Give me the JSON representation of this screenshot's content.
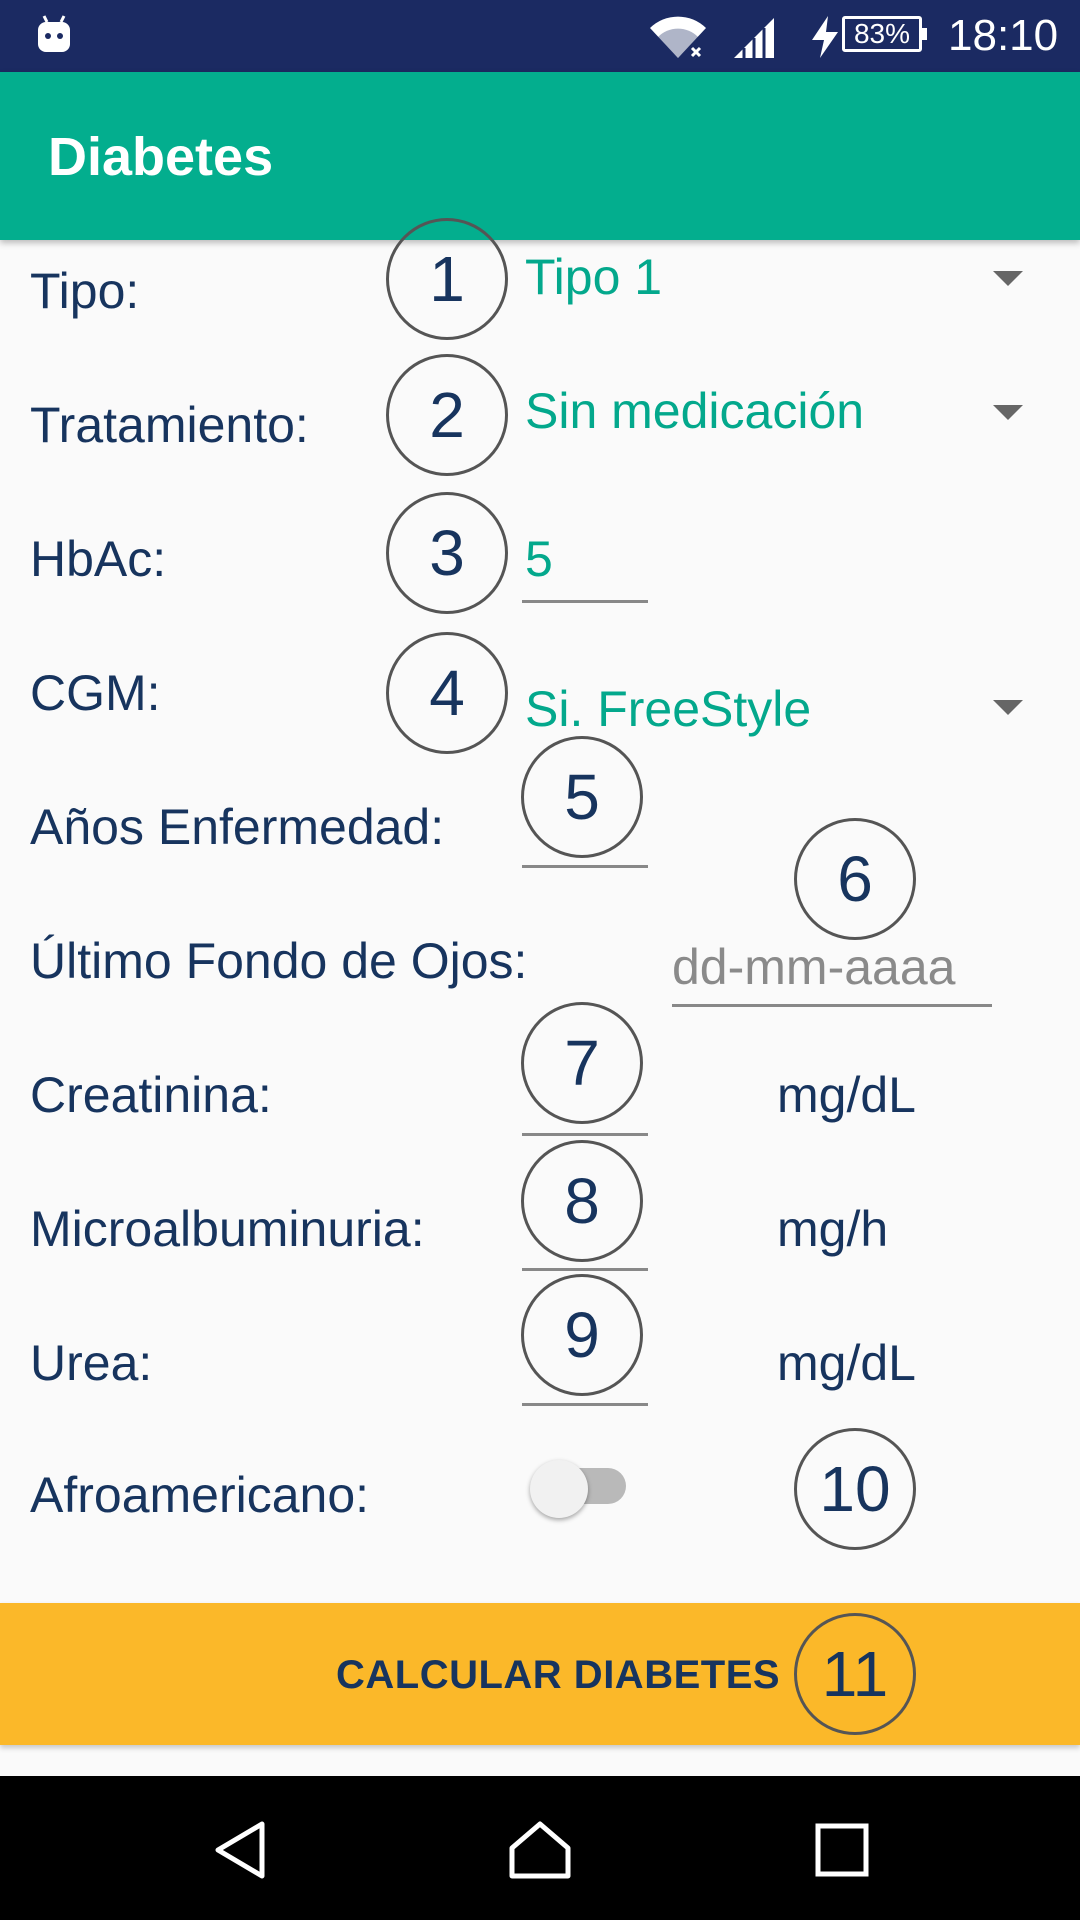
{
  "status_bar": {
    "battery": "83%",
    "time": "18:10",
    "icons": [
      "android-icon",
      "wifi-icon",
      "signal-icon",
      "charging-bolt-icon",
      "battery-icon"
    ]
  },
  "app_bar": {
    "title": "Diabetes"
  },
  "form": {
    "tipo": {
      "label": "Tipo:",
      "value": "Tipo 1"
    },
    "tratamiento": {
      "label": "Tratamiento:",
      "value": "Sin medicación"
    },
    "hbac": {
      "label": "HbAc:",
      "value": "5"
    },
    "cgm": {
      "label": "CGM:",
      "value": "Si. FreeStyle"
    },
    "anos_enfermedad": {
      "label": "Años Enfermedad:",
      "value": ""
    },
    "fondo_ojos": {
      "label": "Último Fondo de Ojos:",
      "placeholder": "dd-mm-aaaa"
    },
    "creatinina": {
      "label": "Creatinina:",
      "unit": "mg/dL"
    },
    "microalbuminuria": {
      "label": "Microalbuminuria:",
      "unit": "mg/h"
    },
    "urea": {
      "label": "Urea:",
      "unit": "mg/dL"
    },
    "afroamericano": {
      "label": "Afroamericano:",
      "checked": false
    }
  },
  "callouts": [
    "1",
    "2",
    "3",
    "4",
    "5",
    "6",
    "7",
    "8",
    "9",
    "10",
    "11"
  ],
  "button": {
    "label": "CALCULAR DIABETES"
  },
  "nav_bar": {
    "icons": [
      "back-icon",
      "home-icon",
      "recents-icon"
    ]
  },
  "colors": {
    "status_bar": "#1b2a62",
    "app_bar": "#03ae8e",
    "accent_text": "#03a88c",
    "label_text": "#17345e",
    "button": "#fbb829"
  }
}
